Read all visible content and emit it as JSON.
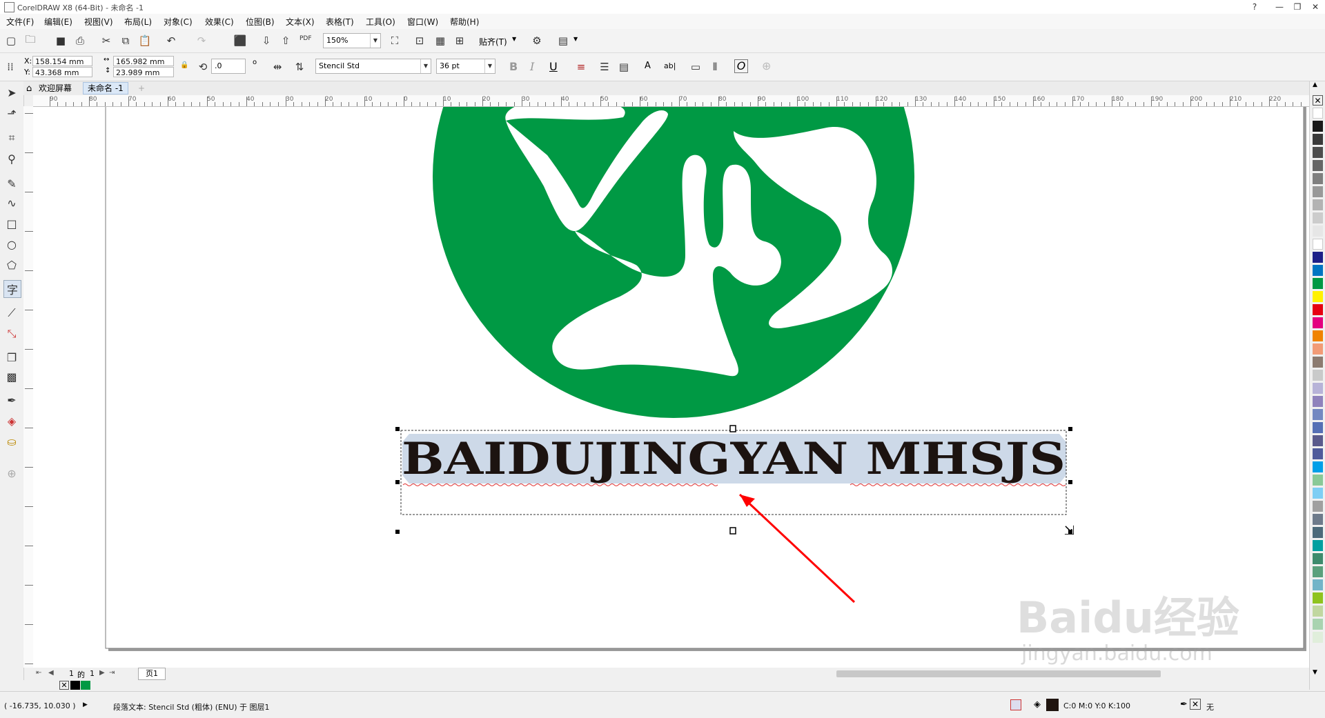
{
  "app": {
    "title": "CorelDRAW X8 (64-Bit) - 未命名 -1",
    "window_buttons": [
      "?",
      "—",
      "❐",
      "✕"
    ]
  },
  "menu": [
    "文件(F)",
    "编辑(E)",
    "视图(V)",
    "布局(L)",
    "对象(C)",
    "效果(C)",
    "位图(B)",
    "文本(X)",
    "表格(T)",
    "工具(O)",
    "窗口(W)",
    "帮助(H)"
  ],
  "standard_toolbar": {
    "zoom_value": "150%",
    "snap_label": "贴齐(T)",
    "pdf_label": "PDF"
  },
  "property_bar": {
    "x_label": "X:",
    "x_value": "158.154 mm",
    "y_label": "Y:",
    "y_value": "43.368 mm",
    "width_value": "165.982 mm",
    "height_value": "23.989 mm",
    "rotation_value": ".0",
    "rotation_unit": "o",
    "font_name": "Stencil Std",
    "font_size": "36 pt",
    "text_style_buttons": [
      "B",
      "I",
      "U"
    ],
    "char_button": "A",
    "ab_button": "ab|",
    "o_button": "O"
  },
  "tabs": {
    "welcome": "欢迎屏幕",
    "document": "未命名 -1",
    "add": "+"
  },
  "ruler": {
    "labels": [
      "90",
      "80",
      "70",
      "60",
      "50",
      "40",
      "30",
      "20",
      "10",
      "0",
      "10",
      "20",
      "30",
      "40",
      "50",
      "60",
      "70",
      "80",
      "90",
      "100",
      "110",
      "120",
      "130",
      "140",
      "150",
      "160",
      "170",
      "180",
      "190",
      "200",
      "210",
      "220"
    ]
  },
  "canvas": {
    "text_object": "BAIDUJINGYAN MHSJS",
    "logo_color": "#009944",
    "selection_color": "#cdd9e8",
    "arrow_color": "#ff0000"
  },
  "page_nav": {
    "current": "1",
    "of_label": "的",
    "total": "1",
    "page_tab": "页1"
  },
  "status": {
    "coords": "( -16.735, 10.030 )",
    "object_info": "段落文本: Stencil Std (粗体) (ENU) 于 图层1",
    "fill_info": "C:0 M:0 Y:0 K:100",
    "outline_info": "无"
  },
  "palette_colors": [
    "#ffffff",
    "#1a1a1a",
    "#3a3a3a",
    "#4d4d4d",
    "#666666",
    "#7f7f7f",
    "#999999",
    "#b3b3b3",
    "#cccccc",
    "#e6e6e6",
    "#ffffff",
    "#1d2088",
    "#0075c2",
    "#009944",
    "#fff100",
    "#e60012",
    "#e4007f",
    "#f08300",
    "#f29b76",
    "#8c7b70",
    "#c9caca",
    "#b7b3d8",
    "#8f82bc",
    "#7388c1",
    "#556fb5",
    "#5a5a8c",
    "#4f5b9b",
    "#009fe8",
    "#89c997",
    "#7ecef4",
    "#a0a0a0",
    "#6e7b8b",
    "#4c6a7a",
    "#00a0a0",
    "#3d8b6d",
    "#5aa07c",
    "#72b4c8",
    "#8fc31f",
    "#c1d7a0",
    "#a9d3b0",
    "#e0eedb"
  ],
  "watermark": {
    "brand": "Baidu",
    "brand_cn": "经验",
    "url": "jingyan.baidu.com"
  }
}
